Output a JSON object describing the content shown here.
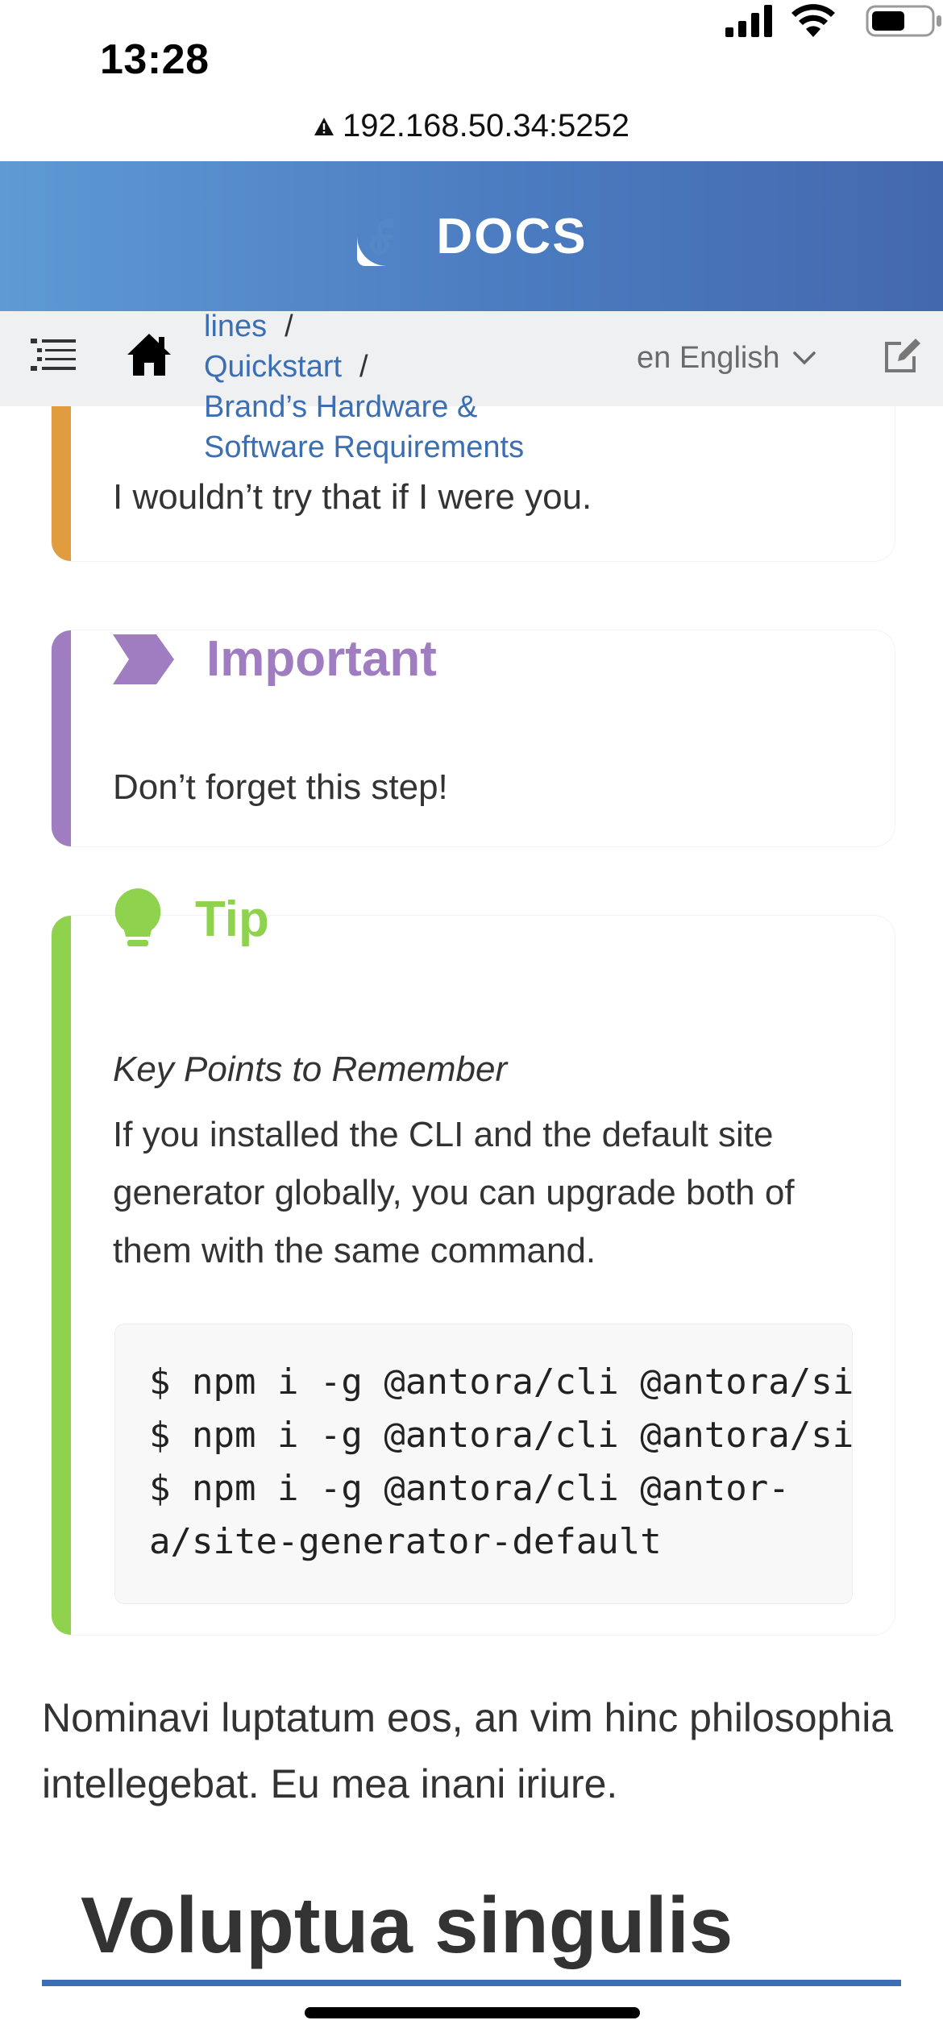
{
  "status_bar": {
    "time": "13:28",
    "url": "192.168.50.34:5252"
  },
  "header": {
    "logo_text": "DOCS",
    "brand_color": "#4b7bc0"
  },
  "toolbar": {
    "breadcrumbs": [
      {
        "label": "lines"
      },
      {
        "label": "Quickstart"
      },
      {
        "label": "Brand’s Hardware & Software Requirements"
      }
    ],
    "separator": "/",
    "language": "en English"
  },
  "admonitions": {
    "warning": {
      "text": "I wouldn’t try that if I were you.",
      "color": "#e09c3f"
    },
    "important": {
      "title": "Important",
      "text": "Don’t forget this step!",
      "color": "#a07cc0"
    },
    "tip": {
      "title": "Tip",
      "subtitle": "Key Points to Remember",
      "body": "If you installed the CLI and the default site generator globally, you can upgrade both of them with the same command.",
      "code_lines": [
        "$ npm i -g @antora/cli @antora/site-generator-default",
        "$ npm i -g @antora/cli @antora/site-generator-default",
        "$ npm i -g @antora/cli @antor-",
        "a/site-generator-default"
      ],
      "color": "#8fd24d"
    }
  },
  "content": {
    "paragraph": "Nominavi luptatum eos, an vim hinc philosophia intellegebat. Eu mea inani iriure.",
    "section_heading": "Voluptua singulis"
  }
}
